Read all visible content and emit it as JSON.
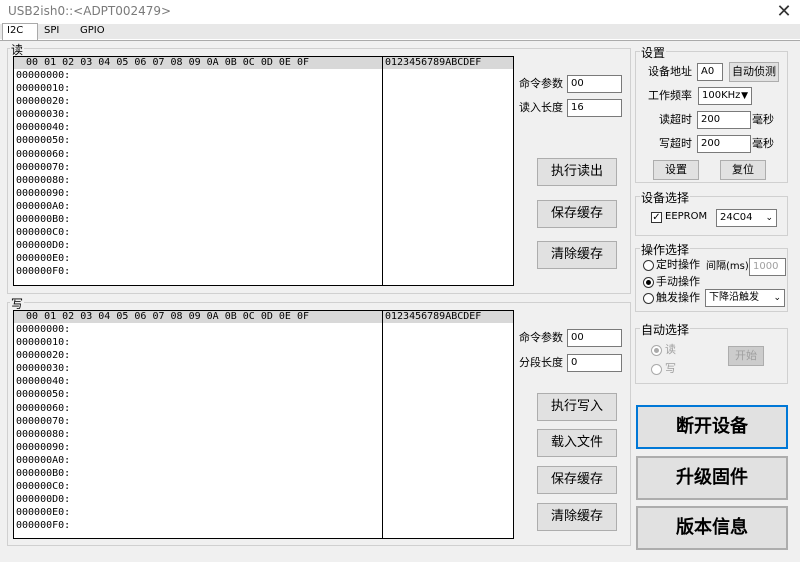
{
  "window": {
    "title": "USB2ish0::<ADPT002479>",
    "close": "✕"
  },
  "tabs": [
    "I2C",
    "SPI",
    "GPIO"
  ],
  "hex": {
    "header_cols": "  00 01 02 03 04 05 06 07 08 09 0A 0B 0C 0D 0E 0F",
    "header_ascii": "0123456789ABCDEF",
    "addresses": [
      "00000000:",
      "00000010:",
      "00000020:",
      "00000030:",
      "00000040:",
      "00000050:",
      "00000060:",
      "00000070:",
      "00000080:",
      "00000090:",
      "000000A0:",
      "000000B0:",
      "000000C0:",
      "000000D0:",
      "000000E0:",
      "000000F0:"
    ]
  },
  "read": {
    "group_label": "读",
    "cmd_label": "命令参数",
    "cmd_value": "00",
    "len_label": "读入长度",
    "len_value": "16",
    "buttons": [
      "执行读出",
      "保存缓存",
      "清除缓存"
    ]
  },
  "write": {
    "group_label": "写",
    "cmd_label": "命令参数",
    "cmd_value": "00",
    "len_label": "分段长度",
    "len_value": "0",
    "buttons": [
      "执行写入",
      "载入文件",
      "保存缓存",
      "清除缓存"
    ]
  },
  "settings": {
    "group_label": "设置",
    "addr_label": "设备地址",
    "addr_value": "A0",
    "detect_button": "自动侦测",
    "freq_label": "工作频率",
    "freq_value": "100KHz",
    "read_timeout_label": "读超时",
    "read_timeout_value": "200",
    "unit_ms": "毫秒",
    "write_timeout_label": "写超时",
    "write_timeout_value": "200",
    "set_button": "设置",
    "reset_button": "复位"
  },
  "device_select": {
    "group_label": "设备选择",
    "eeprom_label": "EEPROM",
    "eeprom_checked": true,
    "chip_value": "24C04"
  },
  "op_select": {
    "group_label": "操作选择",
    "timed_label": "定时操作",
    "interval_label": "间隔(ms)",
    "interval_value": "1000",
    "manual_label": "手动操作",
    "trigger_label": "触发操作",
    "trigger_value": "下降沿触发",
    "selected": "manual"
  },
  "auto_select": {
    "group_label": "自动选择",
    "read_label": "读",
    "write_label": "写",
    "start_button": "开始"
  },
  "big_buttons": [
    "断开设备",
    "升级固件",
    "版本信息"
  ]
}
